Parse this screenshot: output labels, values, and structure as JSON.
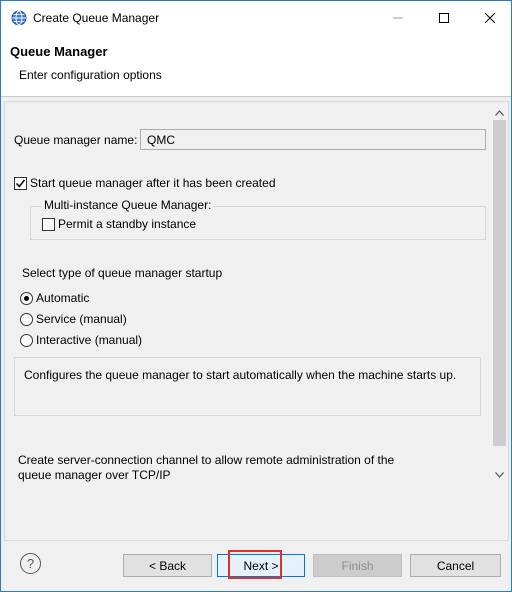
{
  "window": {
    "title": "Create Queue Manager"
  },
  "banner": {
    "title": "Queue Manager",
    "description": "Enter configuration options"
  },
  "form": {
    "queue_manager_name_label": "Queue manager name:",
    "queue_manager_name_value": "QMC",
    "start_after_create_label": "Start queue manager after it has been created",
    "start_after_create_checked": true,
    "multi_instance_group_label": "Multi-instance Queue Manager:",
    "permit_standby_label": "Permit a standby instance",
    "permit_standby_checked": false,
    "startup_type_label": "Select type of queue manager startup",
    "startup_options": [
      {
        "label": "Automatic",
        "selected": true
      },
      {
        "label": "Service (manual)",
        "selected": false
      },
      {
        "label": "Interactive (manual)",
        "selected": false
      }
    ],
    "startup_description": "Configures the queue manager to start automatically when the machine starts up.",
    "channel_text_line1": "Create server-connection channel to allow remote administration of the",
    "channel_text_line2": "queue manager over TCP/IP"
  },
  "buttons": {
    "back": "< Back",
    "next": "Next >",
    "finish": "Finish",
    "cancel": "Cancel"
  },
  "icons": {
    "app": "globe-icon",
    "help": "help-icon",
    "minimize": "minimize-icon",
    "maximize": "maximize-icon",
    "close": "close-icon",
    "scroll_up": "chevron-up-icon",
    "scroll_down": "chevron-down-icon"
  },
  "colors": {
    "highlight_border": "#e0302a",
    "default_button_border": "#0078d7"
  }
}
